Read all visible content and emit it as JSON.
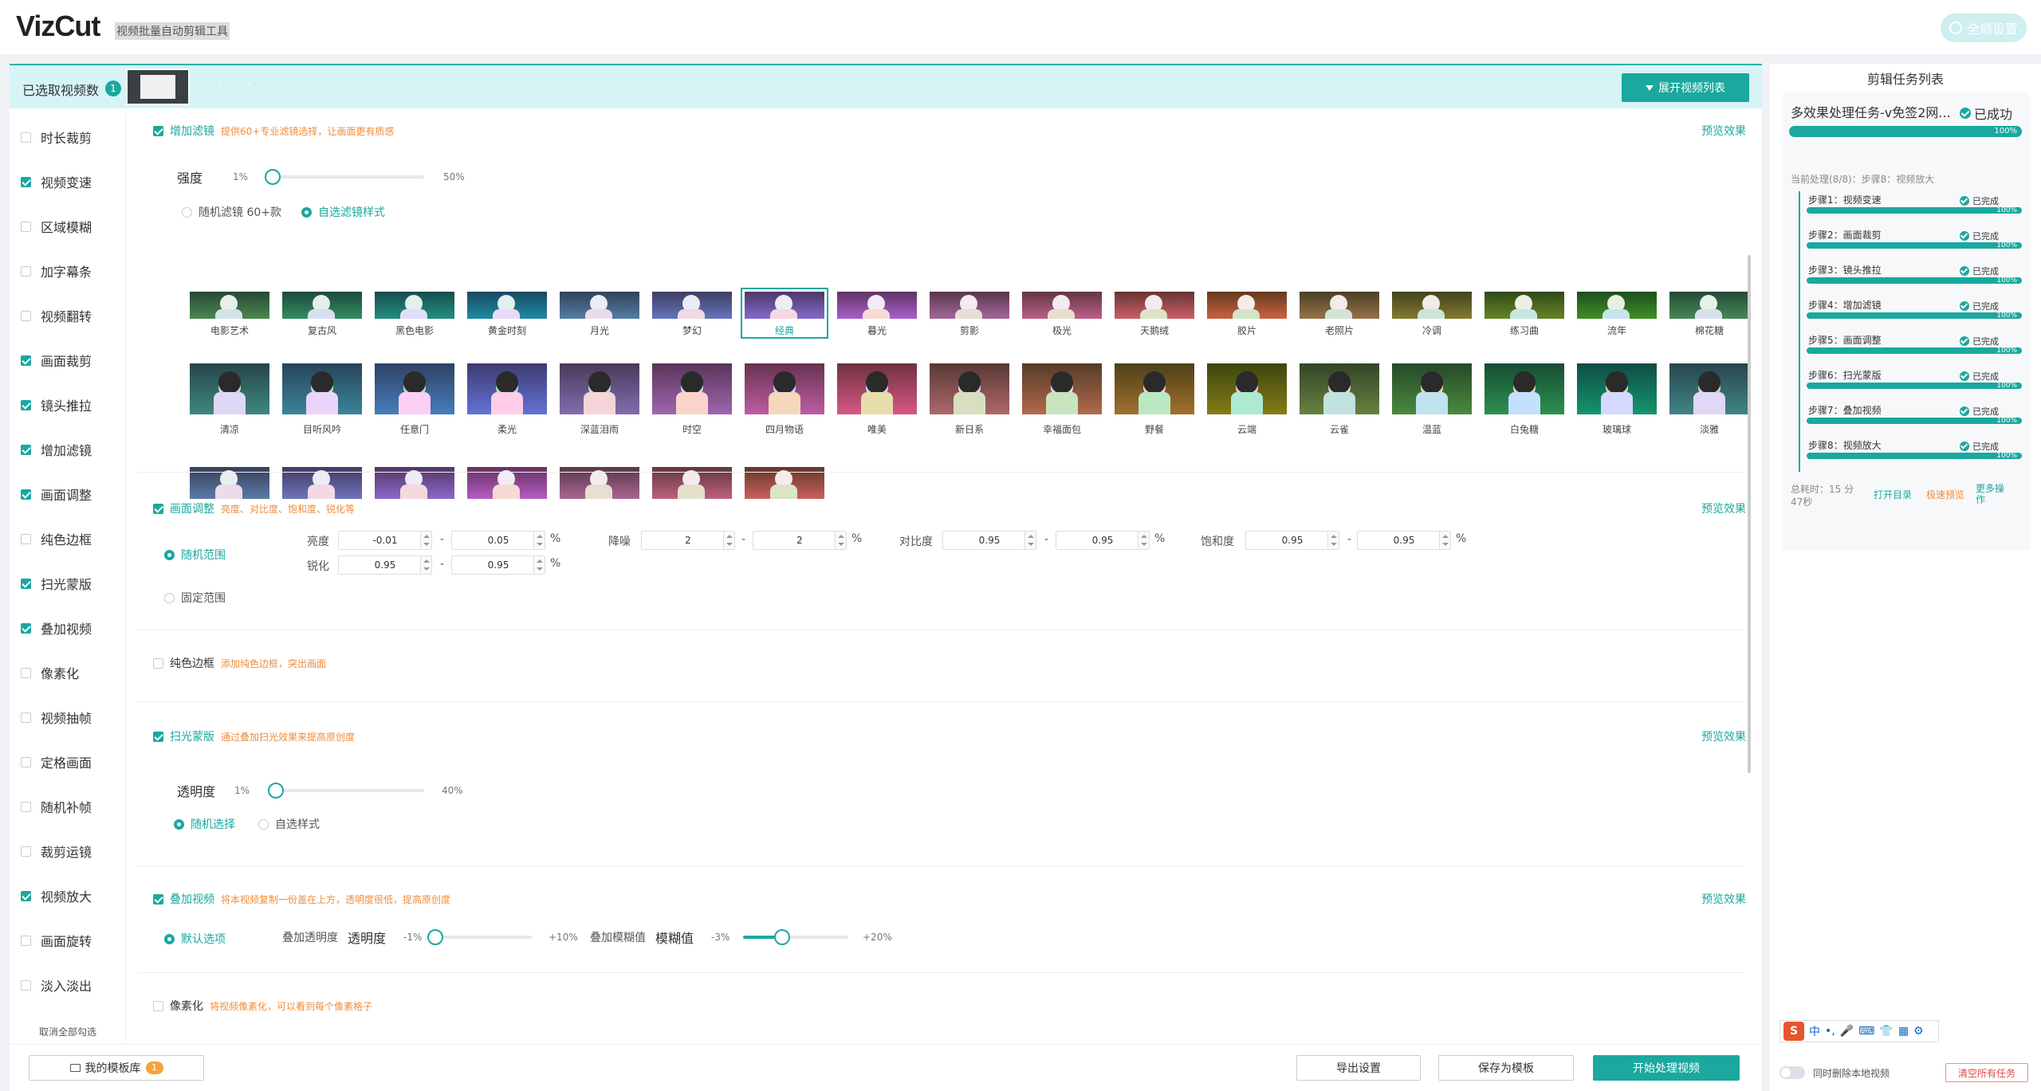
{
  "app": {
    "logo": "VizCut",
    "subtitle": "视频批量自动剪辑工具",
    "global_settings": "全局设置"
  },
  "selection": {
    "label": "已选取视频数",
    "count": "1",
    "dots": "· · ·",
    "expand_label": "展开视频列表"
  },
  "sidebar": {
    "items": [
      {
        "label": "时长裁剪",
        "checked": false
      },
      {
        "label": "视频变速",
        "checked": true
      },
      {
        "label": "区域模糊",
        "checked": false
      },
      {
        "label": "加字幕条",
        "checked": false
      },
      {
        "label": "视频翻转",
        "checked": false
      },
      {
        "label": "画面裁剪",
        "checked": true
      },
      {
        "label": "镜头推拉",
        "checked": true
      },
      {
        "label": "增加滤镜",
        "checked": true
      },
      {
        "label": "画面调整",
        "checked": true
      },
      {
        "label": "纯色边框",
        "checked": false
      },
      {
        "label": "扫光蒙版",
        "checked": true
      },
      {
        "label": "叠加视频",
        "checked": true
      },
      {
        "label": "像素化",
        "checked": false
      },
      {
        "label": "视频抽帧",
        "checked": false
      },
      {
        "label": "定格画面",
        "checked": false
      },
      {
        "label": "随机补帧",
        "checked": false
      },
      {
        "label": "裁剪运镜",
        "checked": false
      },
      {
        "label": "视频放大",
        "checked": true
      },
      {
        "label": "画面旋转",
        "checked": false
      },
      {
        "label": "淡入淡出",
        "checked": false
      }
    ],
    "clear_all": "取消全部勾选"
  },
  "filter": {
    "title": "增加滤镜",
    "desc": "提供60+专业滤镜选择，让画面更有质感",
    "preview": "预览效果",
    "strength_label": "强度",
    "strength_min": "1%",
    "strength_max": "50%",
    "strength_value": 0.0,
    "random_label": "随机滤镜 60+款",
    "custom_label": "自选滤镜样式",
    "row1": [
      "电影艺术",
      "复古风",
      "黑色电影",
      "黄金时刻",
      "月光",
      "梦幻",
      "经典",
      "暮光",
      "剪影",
      "极光",
      "天鹅绒",
      "胶片",
      "老照片",
      "冷调",
      "练习曲",
      "流年",
      "棉花糖"
    ],
    "row2": [
      "清凉",
      "目听风吟",
      "任意门",
      "柔光",
      "深蓝泪雨",
      "时空",
      "四月物语",
      "唯美",
      "新日系",
      "幸福面包",
      "野餐",
      "云端",
      "云雀",
      "温蓝",
      "白兔糖",
      "玻璃球",
      "淡雅"
    ],
    "selected": "经典"
  },
  "adjust": {
    "title": "画面调整",
    "desc": "亮度、对比度、饱和度、锐化等",
    "preview": "预览效果",
    "random_range": "随机范围",
    "fixed_range": "固定范围",
    "brightness": {
      "label": "亮度",
      "min": "-0.01",
      "max": "0.05",
      "unit": "%"
    },
    "denoise": {
      "label": "降噪",
      "min": "2",
      "max": "2",
      "unit": "%"
    },
    "contrast": {
      "label": "对比度",
      "min": "0.95",
      "max": "0.95",
      "unit": "%"
    },
    "saturation": {
      "label": "饱和度",
      "min": "0.95",
      "max": "0.95",
      "unit": "%"
    },
    "sharpen": {
      "label": "锐化",
      "min": "0.95",
      "max": "0.95",
      "unit": "%"
    },
    "dash": "-"
  },
  "border": {
    "title": "纯色边框",
    "desc": "添加纯色边框，突出画面"
  },
  "sweep": {
    "title": "扫光蒙版",
    "desc": "通过叠加扫光效果来提高原创度",
    "preview": "预览效果",
    "opacity_label": "透明度",
    "opacity_min": "1%",
    "opacity_max": "40%",
    "opacity_value": 0.0,
    "random_select": "随机选择",
    "custom_style": "自选样式"
  },
  "overlay": {
    "title": "叠加视频",
    "desc": "将本视频复制一份盖在上方，透明度很低，提高原创度",
    "preview": "预览效果",
    "default_option": "默认选项",
    "opacity_group": "叠加透明度",
    "opacity_label": "透明度",
    "opacity_min": "-1%",
    "opacity_max": "+10%",
    "opacity_value": 0.0,
    "blur_group": "叠加模糊值",
    "blur_label": "模糊值",
    "blur_min": "-3%",
    "blur_max": "+20%",
    "blur_value": 0.35
  },
  "pixelate": {
    "title": "像素化",
    "desc": "将视频像素化，可以看到每个像素格子"
  },
  "bottom": {
    "my_templates": "我的模板库",
    "template_count": "1",
    "export": "导出设置",
    "save_template": "保存为模板",
    "start": "开始处理视频"
  },
  "tasks": {
    "title": "剪辑任务列表",
    "task_name": "多效果处理任务-v免签2网...",
    "status": "已成功",
    "progress": "100%",
    "current": "当前处理(8/8)：步骤8：视频放大",
    "steps": [
      {
        "name": "步骤1：视频变速",
        "status": "已完成",
        "progress": "100%"
      },
      {
        "name": "步骤2：画面裁剪",
        "status": "已完成",
        "progress": "100%"
      },
      {
        "name": "步骤3：镜头推拉",
        "status": "已完成",
        "progress": "100%"
      },
      {
        "name": "步骤4：增加滤镜",
        "status": "已完成",
        "progress": "100%"
      },
      {
        "name": "步骤5：画面调整",
        "status": "已完成",
        "progress": "100%"
      },
      {
        "name": "步骤6：扫光蒙版",
        "status": "已完成",
        "progress": "100%"
      },
      {
        "name": "步骤7：叠加视频",
        "status": "已完成",
        "progress": "100%"
      },
      {
        "name": "步骤8：视频放大",
        "status": "已完成",
        "progress": "100%"
      }
    ],
    "elapsed": "总耗时：15 分47秒",
    "open_dir": "打开目录",
    "quick_preview": "极速预览",
    "more": "更多操作"
  },
  "ime": {
    "s": "S",
    "zh": "中",
    "dot": "•,",
    "mic": "🎤",
    "kb": "⌨",
    "skin": "👕",
    "grid": "▦",
    "more": "⚙"
  },
  "footer": {
    "delete_local": "同时删除本地视频",
    "clear_tasks": "清空所有任务"
  },
  "colors": {
    "accent": "#1aa89f",
    "orange": "#f08c3a",
    "highlight_bg": "#d6f4f6"
  }
}
